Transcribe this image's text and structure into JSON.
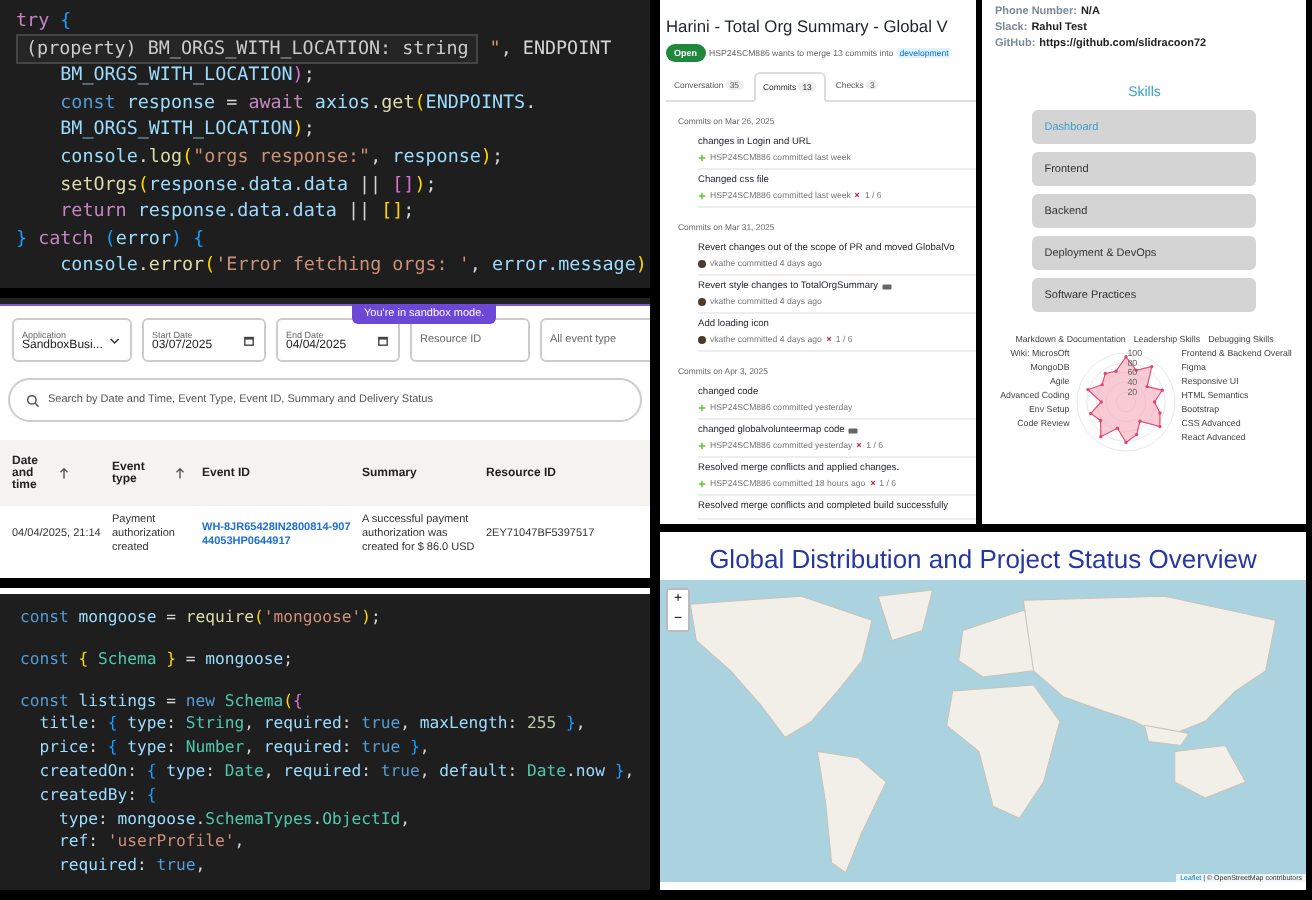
{
  "editor_top": {
    "lines": [
      [
        {
          "kind": "ctrl",
          "t": "try "
        },
        {
          "kind": "br3",
          "t": "{"
        }
      ],
      [
        {
          "kind": "tip",
          "t": "(property) BM_ORGS_WITH_LOCATION: string"
        },
        {
          "kind": "str",
          "t": " \""
        },
        {
          "kind": "p",
          "t": ", ENDPOINT"
        }
      ],
      [
        {
          "kind": "var",
          "t": "    BM_ORGS_WITH_LOCATION"
        },
        {
          "kind": "br2",
          "t": ")"
        },
        {
          "kind": "p",
          "t": ";"
        }
      ],
      [
        {
          "kind": "kw",
          "t": "    const "
        },
        {
          "kind": "var",
          "t": "response"
        },
        {
          "kind": "p",
          "t": " = "
        },
        {
          "kind": "ctrl",
          "t": "await "
        },
        {
          "kind": "var",
          "t": "axios"
        },
        {
          "kind": "p",
          "t": "."
        },
        {
          "kind": "fn",
          "t": "get"
        },
        {
          "kind": "br1",
          "t": "("
        },
        {
          "kind": "var",
          "t": "ENDPOINTS"
        },
        {
          "kind": "p",
          "t": "."
        }
      ],
      [
        {
          "kind": "var",
          "t": "    BM_ORGS_WITH_LOCATION"
        },
        {
          "kind": "br1",
          "t": ")"
        },
        {
          "kind": "p",
          "t": ";"
        }
      ],
      [
        {
          "kind": "var",
          "t": "    console"
        },
        {
          "kind": "p",
          "t": "."
        },
        {
          "kind": "fn",
          "t": "log"
        },
        {
          "kind": "br1",
          "t": "("
        },
        {
          "kind": "str",
          "t": "\"orgs response:\""
        },
        {
          "kind": "p",
          "t": ", "
        },
        {
          "kind": "var",
          "t": "response"
        },
        {
          "kind": "br1",
          "t": ")"
        },
        {
          "kind": "p",
          "t": ";"
        }
      ],
      [
        {
          "kind": "fn",
          "t": "    setOrgs"
        },
        {
          "kind": "br1",
          "t": "("
        },
        {
          "kind": "var",
          "t": "response.data.data"
        },
        {
          "kind": "p",
          "t": " || "
        },
        {
          "kind": "br2",
          "t": "[]"
        },
        {
          "kind": "br1",
          "t": ")"
        },
        {
          "kind": "p",
          "t": ";"
        }
      ],
      [
        {
          "kind": "ctrl",
          "t": "    return "
        },
        {
          "kind": "var",
          "t": "response.data.data"
        },
        {
          "kind": "p",
          "t": " || "
        },
        {
          "kind": "br1",
          "t": "[]"
        },
        {
          "kind": "p",
          "t": ";"
        }
      ],
      [
        {
          "kind": "br3",
          "t": "}"
        },
        {
          "kind": "ctrl",
          "t": " catch "
        },
        {
          "kind": "br3",
          "t": "("
        },
        {
          "kind": "var",
          "t": "error"
        },
        {
          "kind": "br3",
          "t": ") {"
        }
      ],
      [
        {
          "kind": "var",
          "t": "    console"
        },
        {
          "kind": "p",
          "t": "."
        },
        {
          "kind": "fn",
          "t": "error"
        },
        {
          "kind": "br1",
          "t": "("
        },
        {
          "kind": "str",
          "t": "'Error fetching orgs: '"
        },
        {
          "kind": "p",
          "t": ", "
        },
        {
          "kind": "var",
          "t": "error.message"
        },
        {
          "kind": "br1",
          "t": ")"
        }
      ]
    ]
  },
  "events": {
    "banner": "You're in sandbox mode.",
    "filters": [
      {
        "kind": "select",
        "label": "Application",
        "value": "SandboxBusi..."
      },
      {
        "kind": "date",
        "label": "Start Date",
        "value": "03/07/2025"
      },
      {
        "kind": "date",
        "label": "End Date",
        "value": "04/04/2025"
      },
      {
        "kind": "text",
        "placeholder": "Resource ID"
      },
      {
        "kind": "text",
        "placeholder": "All event type"
      }
    ],
    "search": {
      "placeholder": "Search by Date and Time, Event Type, Event ID, Summary and Delivery Status"
    },
    "columns": [
      {
        "label": "Date and time",
        "sortable": true,
        "kind": "text"
      },
      {
        "label": "Event type",
        "sortable": true,
        "kind": "text"
      },
      {
        "label": "Event ID",
        "sortable": false,
        "kind": "link"
      },
      {
        "label": "Summary",
        "sortable": false,
        "kind": "text"
      },
      {
        "label": "Resource ID",
        "sortable": false,
        "kind": "text"
      }
    ],
    "rows": [
      [
        "04/04/2025, 21:14",
        "Payment authorization created",
        "WH-8JR65428IN2800814-90744053HP0644917",
        "A successful payment authorization was created for $ 86.0 USD",
        "2EY71047BF5397517"
      ]
    ]
  },
  "editor_bottom": {
    "lines": [
      {
        "gap": false,
        "tokens": [
          {
            "kind": "kw",
            "t": "const "
          },
          {
            "kind": "var",
            "t": "mongoose"
          },
          {
            "kind": "p",
            "t": " = "
          },
          {
            "kind": "fn",
            "t": "require"
          },
          {
            "kind": "br1",
            "t": "("
          },
          {
            "kind": "str",
            "t": "'mongoose'"
          },
          {
            "kind": "br1",
            "t": ")"
          },
          {
            "kind": "p",
            "t": ";"
          }
        ]
      },
      {
        "gap": true,
        "tokens": [
          {
            "kind": "kw",
            "t": "const "
          },
          {
            "kind": "br1",
            "t": "{ "
          },
          {
            "kind": "cls",
            "t": "Schema"
          },
          {
            "kind": "br1",
            "t": " }"
          },
          {
            "kind": "p",
            "t": " = "
          },
          {
            "kind": "var",
            "t": "mongoose"
          },
          {
            "kind": "p",
            "t": ";"
          }
        ]
      },
      {
        "gap": true,
        "tokens": [
          {
            "kind": "kw",
            "t": "const "
          },
          {
            "kind": "var",
            "t": "listings"
          },
          {
            "kind": "p",
            "t": " = "
          },
          {
            "kind": "kw",
            "t": "new "
          },
          {
            "kind": "cls",
            "t": "Schema"
          },
          {
            "kind": "br1",
            "t": "("
          },
          {
            "kind": "br2",
            "t": "{"
          }
        ]
      },
      {
        "gap": false,
        "tokens": [
          {
            "kind": "var",
            "t": "  title"
          },
          {
            "kind": "p",
            "t": ": "
          },
          {
            "kind": "br3",
            "t": "{ "
          },
          {
            "kind": "var",
            "t": "type"
          },
          {
            "kind": "p",
            "t": ": "
          },
          {
            "kind": "cls",
            "t": "String"
          },
          {
            "kind": "p",
            "t": ", "
          },
          {
            "kind": "var",
            "t": "required"
          },
          {
            "kind": "p",
            "t": ": "
          },
          {
            "kind": "kw",
            "t": "true"
          },
          {
            "kind": "p",
            "t": ", "
          },
          {
            "kind": "var",
            "t": "maxLength"
          },
          {
            "kind": "p",
            "t": ": "
          },
          {
            "kind": "num",
            "t": "255"
          },
          {
            "kind": "br3",
            "t": " }"
          },
          {
            "kind": "p",
            "t": ","
          }
        ]
      },
      {
        "gap": false,
        "tokens": [
          {
            "kind": "var",
            "t": "  price"
          },
          {
            "kind": "p",
            "t": ": "
          },
          {
            "kind": "br3",
            "t": "{ "
          },
          {
            "kind": "var",
            "t": "type"
          },
          {
            "kind": "p",
            "t": ": "
          },
          {
            "kind": "cls",
            "t": "Number"
          },
          {
            "kind": "p",
            "t": ", "
          },
          {
            "kind": "var",
            "t": "required"
          },
          {
            "kind": "p",
            "t": ": "
          },
          {
            "kind": "kw",
            "t": "true"
          },
          {
            "kind": "br3",
            "t": " }"
          },
          {
            "kind": "p",
            "t": ","
          }
        ]
      },
      {
        "gap": false,
        "tokens": [
          {
            "kind": "var",
            "t": "  createdOn"
          },
          {
            "kind": "p",
            "t": ": "
          },
          {
            "kind": "br3",
            "t": "{ "
          },
          {
            "kind": "var",
            "t": "type"
          },
          {
            "kind": "p",
            "t": ": "
          },
          {
            "kind": "cls",
            "t": "Date"
          },
          {
            "kind": "p",
            "t": ", "
          },
          {
            "kind": "var",
            "t": "required"
          },
          {
            "kind": "p",
            "t": ": "
          },
          {
            "kind": "kw",
            "t": "true"
          },
          {
            "kind": "p",
            "t": ", "
          },
          {
            "kind": "var",
            "t": "default"
          },
          {
            "kind": "p",
            "t": ": "
          },
          {
            "kind": "cls",
            "t": "Date"
          },
          {
            "kind": "p",
            "t": "."
          },
          {
            "kind": "var",
            "t": "now"
          },
          {
            "kind": "br3",
            "t": " }"
          },
          {
            "kind": "p",
            "t": ","
          }
        ]
      },
      {
        "gap": false,
        "tokens": [
          {
            "kind": "var",
            "t": "  createdBy"
          },
          {
            "kind": "p",
            "t": ": "
          },
          {
            "kind": "br3",
            "t": "{"
          }
        ]
      },
      {
        "gap": false,
        "tokens": [
          {
            "kind": "var",
            "t": "    type"
          },
          {
            "kind": "p",
            "t": ": "
          },
          {
            "kind": "var",
            "t": "mongoose"
          },
          {
            "kind": "p",
            "t": "."
          },
          {
            "kind": "cls",
            "t": "SchemaTypes"
          },
          {
            "kind": "p",
            "t": "."
          },
          {
            "kind": "cls",
            "t": "ObjectId"
          },
          {
            "kind": "p",
            "t": ","
          }
        ]
      },
      {
        "gap": false,
        "tokens": [
          {
            "kind": "var",
            "t": "    ref"
          },
          {
            "kind": "p",
            "t": ": "
          },
          {
            "kind": "str",
            "t": "'userProfile'"
          },
          {
            "kind": "p",
            "t": ","
          }
        ]
      },
      {
        "gap": false,
        "tokens": [
          {
            "kind": "var",
            "t": "    required"
          },
          {
            "kind": "p",
            "t": ": "
          },
          {
            "kind": "kw",
            "t": "true"
          },
          {
            "kind": "p",
            "t": ","
          }
        ]
      }
    ]
  },
  "pull_request": {
    "title": "Harini - Total Org Summary - Global V",
    "state": "Open",
    "summary": "HSP24SCM886 wants to merge 13 commits into",
    "branch": "development",
    "tabs": [
      {
        "label": "Conversation",
        "count": "35",
        "selected": false
      },
      {
        "label": "Commits",
        "count": "13",
        "selected": true
      },
      {
        "label": "Checks",
        "count": "3",
        "selected": false
      }
    ],
    "groups": [
      {
        "date": "Commits on Mar 26, 2025",
        "commits": [
          {
            "message": "changes in Login and URL",
            "kind": "identicon",
            "meta": "HSP24SCM886 committed last week",
            "comment_icon": false
          },
          {
            "message": "Changed css file",
            "kind": "identicon",
            "meta": "HSP24SCM886 committed last week",
            "comment_icon": false,
            "checks": "1 / 6"
          }
        ]
      },
      {
        "date": "Commits on Mar 31, 2025",
        "commits": [
          {
            "message": "Revert changes out of the scope of PR and moved GlobalVo",
            "kind": "photo",
            "meta": "vkathe committed 4 days ago",
            "comment_icon": false
          },
          {
            "message": "Revert style changes to TotalOrgSummary",
            "kind": "photo",
            "meta": "vkathe committed 4 days ago",
            "comment_icon": true
          },
          {
            "message": "Add loading icon",
            "kind": "photo",
            "meta": "vkathe committed 4 days ago",
            "comment_icon": false,
            "checks": "1 / 6"
          }
        ]
      },
      {
        "date": "Commits on Apr 3, 2025",
        "commits": [
          {
            "message": "changed code",
            "kind": "identicon",
            "meta": "HSP24SCM886 committed yesterday",
            "comment_icon": false
          },
          {
            "message": "changed globalvolunteermap code",
            "kind": "identicon",
            "meta": "HSP24SCM886 committed yesterday",
            "comment_icon": true,
            "checks": "1 / 6"
          },
          {
            "message": "Resolved merge conflicts and applied changes.",
            "kind": "identicon",
            "meta": "HSP24SCM886 committed 18 hours ago",
            "comment_icon": false,
            "checks": "1 / 6"
          },
          {
            "message": "Resolved merge conflicts and completed build successfully",
            "comment_icon": false
          }
        ]
      }
    ]
  },
  "profile": {
    "fields": [
      {
        "label": "Phone Number:",
        "value": "N/A"
      },
      {
        "label": "Slack:",
        "value": "Rahul Test"
      },
      {
        "label": "GitHub:",
        "value": "https://github.com/slidracoon72"
      }
    ],
    "skills_title": "Skills",
    "skills": [
      {
        "label": "Dashboard",
        "selected": true
      },
      {
        "label": "Frontend",
        "selected": false
      },
      {
        "label": "Backend",
        "selected": false
      },
      {
        "label": "Deployment & DevOps",
        "selected": false
      },
      {
        "label": "Software Practices",
        "selected": false
      }
    ],
    "radar": {
      "top_labels": [
        "Markdown & Documentation",
        "Leadership Skills",
        "Debugging Skills"
      ],
      "left_labels": [
        "Wiki: MicrosOft",
        "MongoDB",
        "Agile",
        "Advanced Coding",
        "Env Setup",
        "Code Review"
      ],
      "right_labels": [
        "Frontend & Backend Overall",
        "Figma",
        "Responsive UI",
        "HTML Semantics",
        "Bootstrap",
        "CSS Advanced",
        "React Advanced"
      ],
      "ticks": [
        "100",
        "80",
        "60",
        "40",
        "20"
      ]
    }
  },
  "map": {
    "title": "Global Distribution and Project Status Overview",
    "zoom_in": "+",
    "zoom_out": "−",
    "attribution_link": "Leaflet",
    "attribution": "| © OpenStreetMap contributors"
  }
}
